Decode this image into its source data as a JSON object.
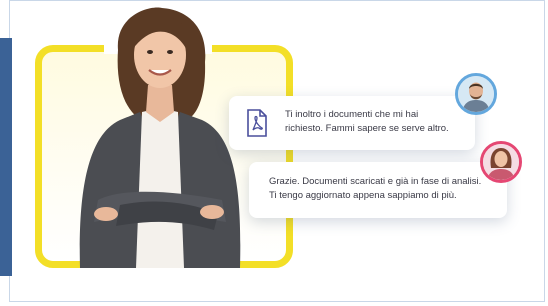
{
  "messages": [
    {
      "text": "Ti inoltro i documenti che mi hai\nrichiesto. Fammi sapere se serve altro.",
      "icon": "pdf-file-icon"
    },
    {
      "text": "Grazie. Documenti scaricati e già in fase di analisi.\nTi tengo aggiornato appena sappiamo di più."
    }
  ],
  "colors": {
    "brand_blue": "#3b6296",
    "highlight_yellow": "#f3df27",
    "pdf_accent": "#4a4f9c",
    "avatar_man_ring": "#63a7dd",
    "avatar_woman_ring": "#e54773"
  }
}
